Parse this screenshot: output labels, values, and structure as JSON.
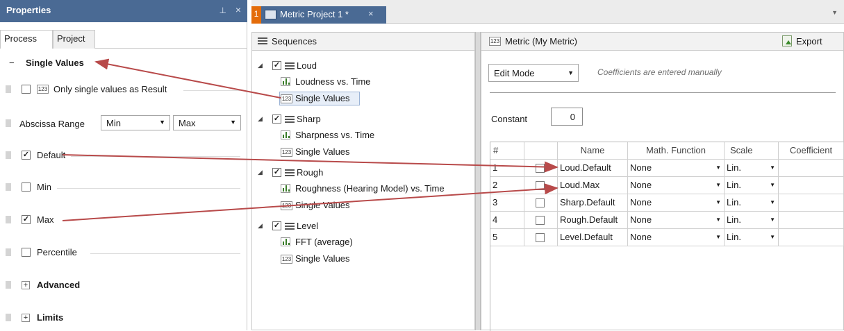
{
  "properties": {
    "title": "Properties",
    "tabs": [
      "Process",
      "Project"
    ],
    "single_values_header": "Single Values",
    "only_single_label": "Only single values as Result",
    "abscissa_label": "Abscissa Range",
    "abscissa_min": "Min",
    "abscissa_max": "Max",
    "items": [
      {
        "label": "Default",
        "checked": true
      },
      {
        "label": "Min",
        "checked": false
      },
      {
        "label": "Max",
        "checked": true
      },
      {
        "label": "Percentile",
        "checked": false
      }
    ],
    "advanced": "Advanced",
    "limits": "Limits"
  },
  "doc_tab": {
    "number": "1",
    "label": "Metric Project 1 *"
  },
  "sequences": {
    "title": "Sequences",
    "groups": [
      {
        "name": "Loud",
        "children": [
          "Loudness vs. Time",
          "Single Values"
        ]
      },
      {
        "name": "Sharp",
        "children": [
          "Sharpness vs. Time",
          "Single Values"
        ]
      },
      {
        "name": "Rough",
        "children": [
          "Roughness (Hearing Model) vs. Time",
          "Single Values"
        ]
      },
      {
        "name": "Level",
        "children": [
          "FFT (average)",
          "Single Values"
        ]
      }
    ]
  },
  "metric": {
    "title": "Metric (My Metric)",
    "export": "Export",
    "mode": "Edit Mode",
    "hint": "Coefficients are entered manually",
    "constant_label": "Constant",
    "constant_value": "0",
    "columns": [
      "#",
      "",
      "Name",
      "Math. Function",
      "Scale",
      "Coefficient"
    ],
    "rows": [
      {
        "num": "1",
        "name": "Loud.Default",
        "func": "None",
        "scale": "Lin."
      },
      {
        "num": "2",
        "name": "Loud.Max",
        "func": "None",
        "scale": "Lin."
      },
      {
        "num": "3",
        "name": "Sharp.Default",
        "func": "None",
        "scale": "Lin."
      },
      {
        "num": "4",
        "name": "Rough.Default",
        "func": "None",
        "scale": "Lin."
      },
      {
        "num": "5",
        "name": "Level.Default",
        "func": "None",
        "scale": "Lin."
      }
    ]
  },
  "icons": {
    "badge": "123",
    "check": "✓",
    "plus": "+",
    "minus": "−",
    "pin": "⊥",
    "close": "×"
  },
  "colors": {
    "titlebar": "#4a6a94",
    "accent": "#e46c0a",
    "annotation_arrow": "#b84a4a"
  }
}
